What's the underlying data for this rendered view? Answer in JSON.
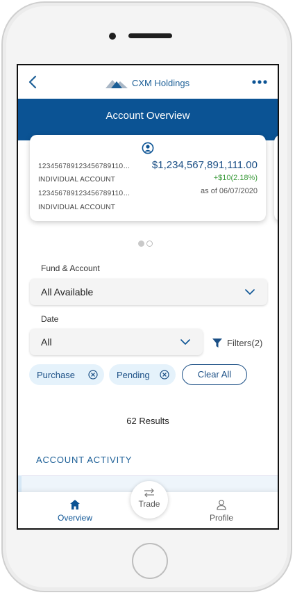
{
  "app": {
    "brand": "CXM Holdings",
    "banner_title": "Account Overview"
  },
  "account_card": {
    "account_number_1": "123456789123456789110…",
    "account_type_1": "INDIVIDUAL ACCOUNT",
    "account_number_2": "123456789123456789110…",
    "account_type_2": "INDIVIDUAL ACCOUNT",
    "balance": "$1,234,567,891,111.00",
    "change": "+$10(2.18%)",
    "as_of": "as of 06/07/2020"
  },
  "pager": {
    "total": 2,
    "current": 1
  },
  "filters": {
    "fund_label": "Fund & Account",
    "fund_value": "All Available",
    "date_label": "Date",
    "date_value": "All",
    "filters_button": "Filters(2)",
    "chips": [
      "Purchase",
      "Pending"
    ],
    "clear_all": "Clear All"
  },
  "results": "62 Results",
  "activity": {
    "title": "ACCOUNT ACTIVITY"
  },
  "tabs": {
    "overview": "Overview",
    "trade": "Trade",
    "profile": "Profile"
  },
  "colors": {
    "brand_blue": "#0b5394",
    "link_blue": "#1b5e96",
    "positive_green": "#3a9a3a",
    "chip_bg": "#e5f2fb"
  },
  "icons": [
    "back-arrow-icon",
    "mountain-logo-icon",
    "more-dots-icon",
    "user-circle-icon",
    "chevron-down-icon",
    "filter-icon",
    "close-circle-icon",
    "home-icon",
    "swap-icon",
    "person-icon"
  ]
}
